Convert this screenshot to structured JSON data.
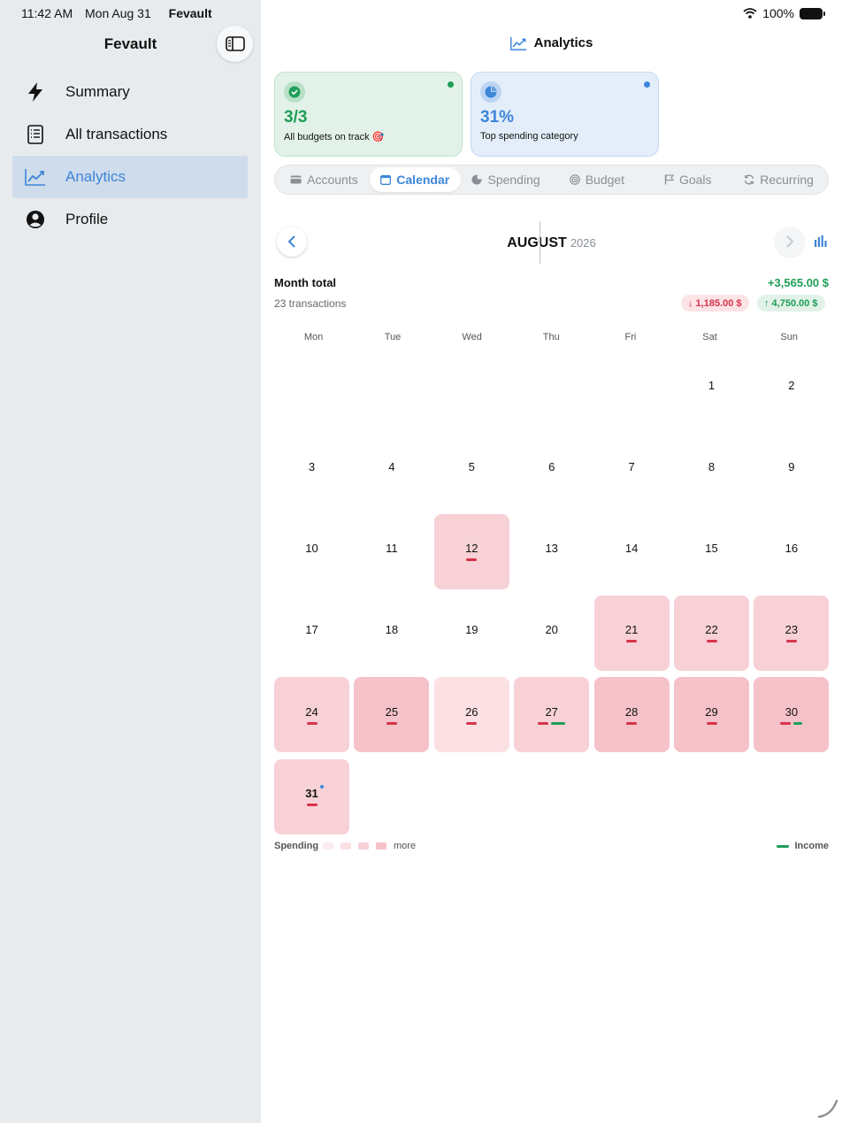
{
  "status_bar": {
    "time": "11:42 AM",
    "date": "Mon Aug 31",
    "app": "Fevault",
    "battery": "100%"
  },
  "sidebar": {
    "title": "Fevault",
    "items": [
      {
        "label": "Summary",
        "icon": "bolt-icon"
      },
      {
        "label": "All transactions",
        "icon": "receipt-icon"
      },
      {
        "label": "Analytics",
        "icon": "chart-line-icon",
        "active": true
      },
      {
        "label": "Profile",
        "icon": "person-circle-icon"
      }
    ]
  },
  "header": {
    "title": "Analytics"
  },
  "cards": [
    {
      "value": "3/3",
      "label": "All budgets on track 🎯",
      "color": "#1e9e57"
    },
    {
      "value": "31%",
      "label": "Top spending category",
      "color": "#3d86d8"
    }
  ],
  "tabs": [
    {
      "label": "Accounts",
      "icon": "card-icon"
    },
    {
      "label": "Calendar",
      "icon": "calendar-icon",
      "active": true
    },
    {
      "label": "Spending",
      "icon": "pie-icon"
    },
    {
      "label": "Budget",
      "icon": "target-icon"
    },
    {
      "label": "Goals",
      "icon": "flag-icon"
    },
    {
      "label": "Recurring",
      "icon": "repeat-icon"
    }
  ],
  "calendar": {
    "month": "AUGUST",
    "year": "2026",
    "month_total_label": "Month total",
    "month_total": "+3,565.00 $",
    "transactions": "23 transactions",
    "spent": "↓ 1,185.00 $",
    "income": "↑ 4,750.00 $",
    "weekdays": [
      "Mon",
      "Tue",
      "Wed",
      "Thu",
      "Fri",
      "Sat",
      "Sun"
    ],
    "first_weekday_index": 5,
    "days_in_month": 31,
    "today": 31,
    "day_activity": {
      "12": {
        "level": 2,
        "spend": true
      },
      "21": {
        "level": 2,
        "spend": true
      },
      "22": {
        "level": 2,
        "spend": true
      },
      "23": {
        "level": 2,
        "spend": true
      },
      "24": {
        "level": 2,
        "spend": true
      },
      "25": {
        "level": 3,
        "spend": true
      },
      "26": {
        "level": 1,
        "spend": true
      },
      "27": {
        "level": 2,
        "spend": true,
        "income": true
      },
      "28": {
        "level": 3,
        "spend": true
      },
      "29": {
        "level": 3,
        "spend": true
      },
      "30": {
        "level": 3,
        "spend": true,
        "income": true
      },
      "31": {
        "level": 2,
        "spend": true
      }
    }
  },
  "legend": {
    "spending": "Spending",
    "more": "more",
    "income": "Income"
  },
  "colors": {
    "accent": "#3d86d8",
    "income": "#1e9e57",
    "spending": "#d6334a"
  }
}
